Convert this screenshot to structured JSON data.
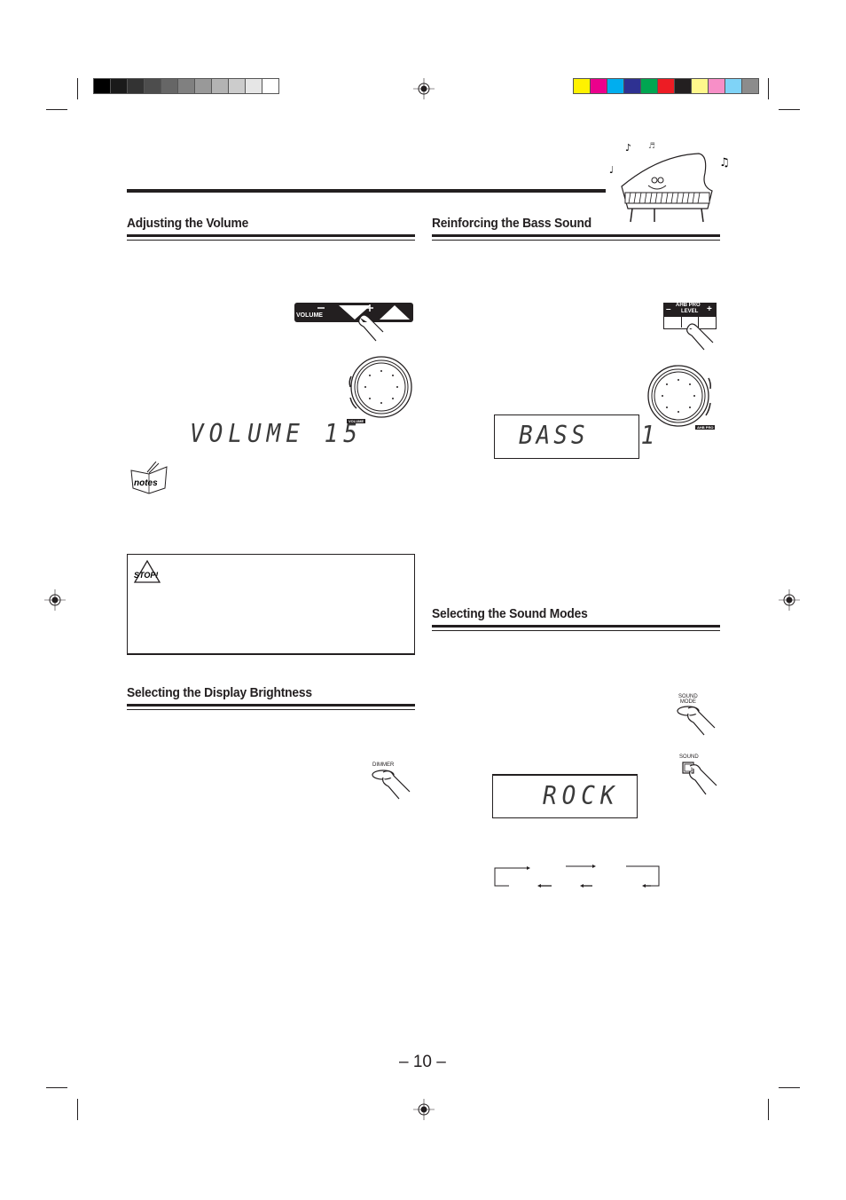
{
  "calibration": {
    "grayscale_colors": [
      "#000000",
      "#1a1a1a",
      "#333333",
      "#4d4d4d",
      "#666666",
      "#808080",
      "#999999",
      "#b3b3b3",
      "#cccccc",
      "#e6e6e6",
      "#ffffff"
    ],
    "color_swatches": [
      "#fff200",
      "#ec008c",
      "#00aeef",
      "#2e3192",
      "#00a651",
      "#ed1c24",
      "#231f20",
      "#fff78c",
      "#f78fc7",
      "#7fd3f7",
      "#8c8c8c"
    ]
  },
  "sections": {
    "volume": {
      "title": "Adjusting the Volume",
      "remote_button_label": "VOLUME",
      "remote_minus": "–",
      "remote_plus": "+",
      "knob_label": "VOLUME",
      "display_text": "VOLUME 15",
      "notes_icon_label": "notes",
      "caution_icon_label": "STOP!"
    },
    "bass": {
      "title": "Reinforcing the Bass Sound",
      "button_label_line1": "AHB PRO",
      "button_label_line2": "LEVEL",
      "button_minus": "–",
      "button_plus": "+",
      "knob_label": "AHB PRO",
      "display_text": "BASS   1"
    },
    "sound_modes": {
      "title": "Selecting the Sound Modes",
      "remote_button_label_line1": "SOUND",
      "remote_button_label_line2": "MODE",
      "unit_button_label": "SOUND",
      "display_text": "ROCK"
    },
    "brightness": {
      "title": "Selecting the Display Brightness",
      "button_label": "DIMMER"
    }
  },
  "footer": {
    "page_number": "– 10 –"
  }
}
